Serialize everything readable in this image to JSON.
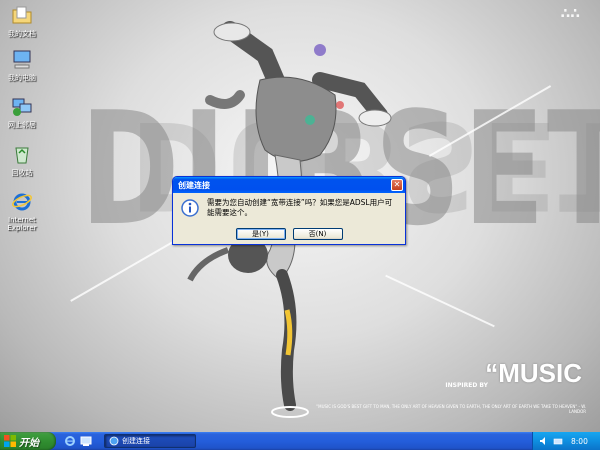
{
  "wallpaper": {
    "line1": "DUBSET",
    "line2": "DUBSET",
    "music": "“MUSIC",
    "inspired": "INSPIRED BY",
    "quote": "\"MUSIC IS GOD'S BEST GIFT TO MAN, THE ONLY ART OF HEAVEN GIVEN TO EARTH, THE ONLY ART OF EARTH WE TAKE TO HEAVEN\" - W. LANDOR",
    "corner_mark": "∴∴"
  },
  "desktop_icons": [
    {
      "name": "desktop-icon-my-documents",
      "label": "我的文档",
      "icon": "folder-documents-icon"
    },
    {
      "name": "desktop-icon-my-computer",
      "label": "我的电脑",
      "icon": "computer-icon"
    },
    {
      "name": "desktop-icon-network",
      "label": "网上邻居",
      "icon": "network-icon"
    },
    {
      "name": "desktop-icon-recycle-bin",
      "label": "回收站",
      "icon": "recycle-bin-icon"
    },
    {
      "name": "desktop-icon-ie",
      "label": "Internet Explorer",
      "icon": "internet-explorer-icon"
    }
  ],
  "dialog": {
    "title": "创建连接",
    "message": "需要为您自动创建“宽带连接”吗？如果您是ADSL用户可能需要这个。",
    "yes_label": "是(Y)",
    "no_label": "否(N)",
    "close_glyph": "✕"
  },
  "taskbar": {
    "start_label": "开始",
    "task_label": "创建连接",
    "time": "8:00"
  },
  "colors": {
    "titlebar_blue": "#0053ee",
    "taskbar_blue": "#245edb",
    "start_green": "#3c9b3c",
    "tray_blue": "#0f8ee0"
  }
}
